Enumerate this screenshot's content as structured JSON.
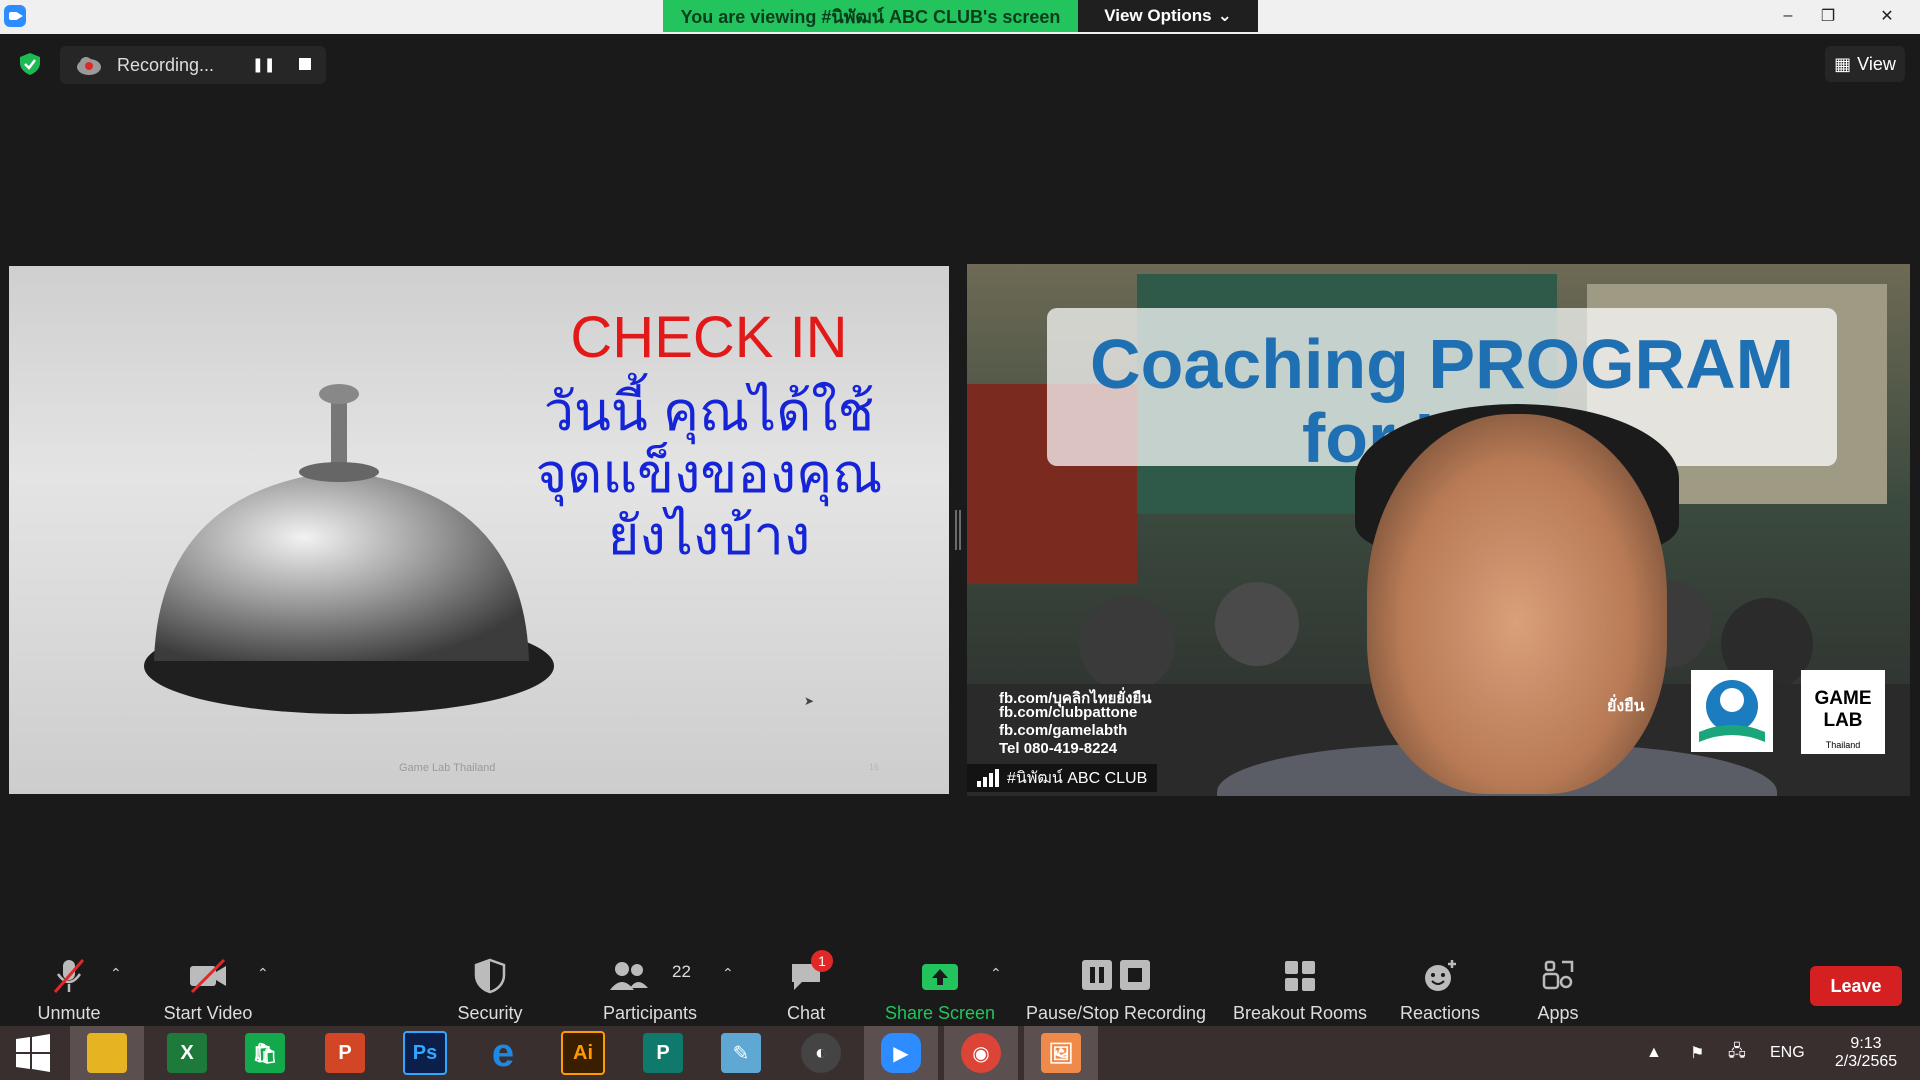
{
  "titlebar": {
    "banner": "You are viewing #นิพัฒน์ ABC CLUB's screen",
    "view_options": "View Options"
  },
  "recording": {
    "label": "Recording..."
  },
  "view_button": {
    "label": "View"
  },
  "shared_slide": {
    "line1": "CHECK IN",
    "line2": "วันนี้ คุณได้ใช้",
    "line3": "จุดแข็งของคุณ",
    "line4": "ยังไงบ้าง",
    "footer": "Game Lab Thailand",
    "page": "16"
  },
  "participant_video": {
    "title": "Coaching PROGRAM",
    "subtitle": "for Le        er",
    "contacts": [
      "fb.com/บุคลิกไทยยั่งยืน",
      "fb.com/clubpattone",
      "fb.com/gamelabth",
      "Tel 080-419-8224"
    ],
    "logo_text": "GAME LAB",
    "logo_sub": "Thailand",
    "side_text": "ยั่งยืน",
    "name": "#นิพัฒน์ ABC CLUB"
  },
  "toolbar": {
    "unmute": "Unmute",
    "start_video": "Start Video",
    "security": "Security",
    "participants": "Participants",
    "participants_count": "22",
    "chat": "Chat",
    "chat_badge": "1",
    "share_screen": "Share Screen",
    "pause_stop": "Pause/Stop Recording",
    "breakout": "Breakout Rooms",
    "reactions": "Reactions",
    "apps": "Apps",
    "leave": "Leave"
  },
  "taskbar": {
    "apps": [
      {
        "name": "explorer-app",
        "color": "#e6b422"
      },
      {
        "name": "excel-app",
        "label": "X",
        "color": "#1d7a3a"
      },
      {
        "name": "store-app",
        "label": "🛍",
        "color": "#13a84b"
      },
      {
        "name": "powerpoint-app",
        "label": "P",
        "color": "#d24625"
      },
      {
        "name": "photoshop-app",
        "label": "Ps",
        "color": "#0b1f4a"
      },
      {
        "name": "ie-app",
        "label": "e",
        "color": "#1e88e5"
      },
      {
        "name": "illustrator-app",
        "label": "Ai",
        "color": "#3a1e00"
      },
      {
        "name": "publisher-app",
        "label": "P",
        "color": "#0f7a6b"
      },
      {
        "name": "paint-app",
        "label": "✎",
        "color": "#5fa8d3"
      },
      {
        "name": "photoscape-app",
        "label": "◐",
        "color": "#444"
      },
      {
        "name": "zoom-app",
        "label": "▶",
        "color": "#2d8cff"
      },
      {
        "name": "chrome-app",
        "label": "◉",
        "color": "#db4437"
      },
      {
        "name": "meeting-app",
        "label": "🖼",
        "color": "#f08a4b"
      }
    ],
    "lang": "ENG",
    "time": "9:13",
    "date": "2/3/2565"
  }
}
